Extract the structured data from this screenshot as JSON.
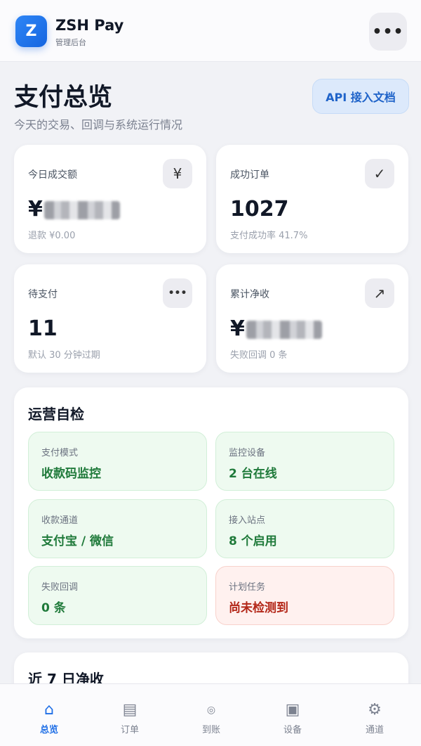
{
  "header": {
    "logo_letter": "Z",
    "app_name": "ZSH Pay",
    "app_subtitle": "管理后台",
    "menu_glyph": "•••"
  },
  "page": {
    "title": "支付总览",
    "subtitle": "今天的交易、回调与系统运行情况",
    "api_button": "API 接入文档"
  },
  "stats": [
    {
      "label": "今日成交额",
      "icon_name": "yuan-icon",
      "icon": "¥",
      "value_prefix": "¥",
      "value_masked": true,
      "note": "退款 ¥0.00"
    },
    {
      "label": "成功订单",
      "icon_name": "checkmark-icon",
      "icon": "✓",
      "value": "1027",
      "note": "支付成功率 41.7%"
    },
    {
      "label": "待支付",
      "icon_name": "more-icon",
      "icon": "•••",
      "value": "11",
      "note": "默认 30 分钟过期"
    },
    {
      "label": "累计净收",
      "icon_name": "trend-up-icon",
      "icon": "↗",
      "value_prefix": "¥",
      "value_masked": true,
      "note": "失败回调 0 条"
    }
  ],
  "ops": {
    "title": "运营自检",
    "items": [
      {
        "label": "支付模式",
        "value": "收款码监控",
        "status": "ok"
      },
      {
        "label": "监控设备",
        "value": "2 台在线",
        "status": "ok"
      },
      {
        "label": "收款通道",
        "value": "支付宝 / 微信",
        "status": "ok"
      },
      {
        "label": "接入站点",
        "value": "8 个启用",
        "status": "ok"
      },
      {
        "label": "失败回调",
        "value": "0 条",
        "status": "ok"
      },
      {
        "label": "计划任务",
        "value": "尚未检测到",
        "status": "warn"
      }
    ]
  },
  "trend": {
    "title": "近 7 日净收"
  },
  "tabbar": {
    "active_index": 0,
    "tabs": [
      {
        "label": "总览",
        "icon_name": "home-icon",
        "icon": "⌂"
      },
      {
        "label": "订单",
        "icon_name": "list-icon",
        "icon": "▤"
      },
      {
        "label": "到账",
        "icon_name": "target-icon",
        "icon": "◎"
      },
      {
        "label": "设备",
        "icon_name": "device-icon",
        "icon": "▣"
      },
      {
        "label": "通道",
        "icon_name": "gear-icon",
        "icon": "⚙"
      }
    ]
  },
  "colors": {
    "accent": "#1e6ee6",
    "ok_text": "#1f7a3a",
    "warn_text": "#b32718",
    "ok_bg": "#eefaf0",
    "warn_bg": "#fff1ef"
  }
}
